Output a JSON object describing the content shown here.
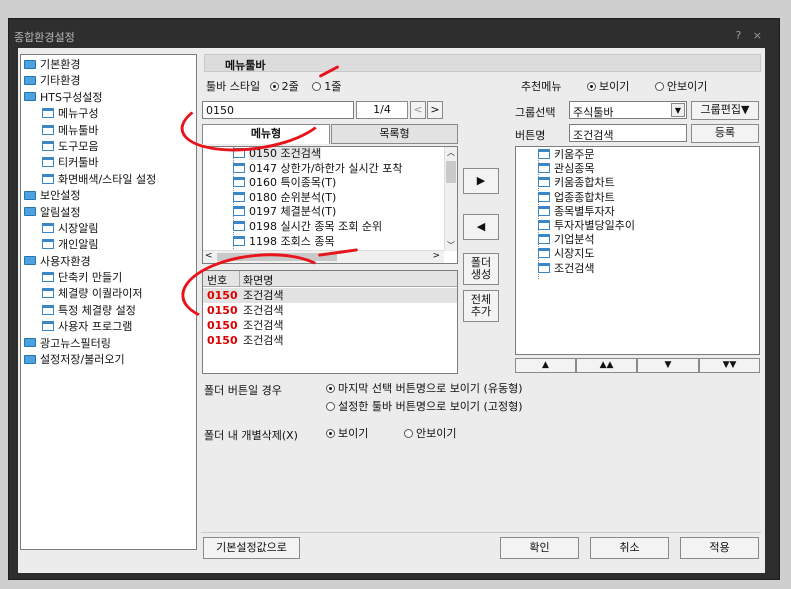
{
  "window": {
    "title": "종합환경설정",
    "controls": "? ×"
  },
  "left_tree": [
    {
      "label": "기본환경",
      "icon": "folder",
      "indent": 0
    },
    {
      "label": "기타환경",
      "icon": "folder",
      "indent": 0
    },
    {
      "label": "HTS구성설정",
      "icon": "folder",
      "indent": 0
    },
    {
      "label": "메뉴구성",
      "icon": "window",
      "indent": 1
    },
    {
      "label": "메뉴툴바",
      "icon": "window",
      "indent": 1
    },
    {
      "label": "도구모음",
      "icon": "window",
      "indent": 1
    },
    {
      "label": "티커툴바",
      "icon": "window",
      "indent": 1
    },
    {
      "label": "화면배색/스타일 설정",
      "icon": "window",
      "indent": 1
    },
    {
      "label": "보안설정",
      "icon": "folder",
      "indent": 0
    },
    {
      "label": "알림설정",
      "icon": "folder",
      "indent": 0
    },
    {
      "label": "시장알림",
      "icon": "window",
      "indent": 1
    },
    {
      "label": "개인알림",
      "icon": "window",
      "indent": 1
    },
    {
      "label": "사용자환경",
      "icon": "folder",
      "indent": 0
    },
    {
      "label": "단축키 만들기",
      "icon": "window",
      "indent": 1
    },
    {
      "label": "체결량 이퀄라이저",
      "icon": "window",
      "indent": 1
    },
    {
      "label": "특정 체결량 설정",
      "icon": "window",
      "indent": 1
    },
    {
      "label": "사용자 프로그램",
      "icon": "window",
      "indent": 1
    },
    {
      "label": "광고뉴스필터링",
      "icon": "folder",
      "indent": 0
    },
    {
      "label": "설정저장/불러오기",
      "icon": "folder",
      "indent": 0
    }
  ],
  "panel": {
    "title": "메뉴툴바",
    "toolbar_style_label": "툴바 스타일",
    "style_options": [
      "2줄",
      "1줄"
    ],
    "recommend_label": "추천메뉴",
    "recommend_options": [
      "보이기",
      "안보이기"
    ],
    "search_value": "0150",
    "page_indicator": "1/4",
    "tabs": [
      "메뉴형",
      "목록형"
    ],
    "menu_list": [
      "0150 조건검색",
      "0147 상한가/하한가 실시간 포착",
      "0160 특이종목(T)",
      "0180 순위분석(T)",
      "0197 체결분석(T)",
      "0198 실시간 종목 조회 순위",
      "1198 조회스 종목"
    ],
    "result_headers": [
      "번호",
      "화면명"
    ],
    "result_rows": [
      {
        "code": "0150",
        "name": "조건검색"
      },
      {
        "code": "0150",
        "name": "조건검색"
      },
      {
        "code": "0150",
        "name": "조건검색"
      },
      {
        "code": "0150",
        "name": "조건검색"
      }
    ],
    "add_arrow": "▶",
    "remove_arrow": "◀",
    "folder_create_label": "폴더\n생성",
    "add_all_label": "전체\n추가",
    "group_select_label": "그룹선택",
    "group_select_value": "주식툴바",
    "group_edit_label": "그룹편집▼",
    "button_name_label": "버튼명",
    "button_name_value": "조건검색",
    "register_label": "등록",
    "toolbar_items": [
      "키움주문",
      "관심종목",
      "키움종합차트",
      "업종종합차트",
      "종목별투자자",
      "투자자별당일추이",
      "기업분석",
      "시장지도",
      "조건검색"
    ],
    "move_buttons": [
      "▲",
      "▲▲",
      "▼",
      "▼▼"
    ],
    "folder_button_label": "폴더 버튼일 경우",
    "folder_button_options": [
      "마지막 선택 버튼명으로 보이기 (유동형)",
      "설정한 툴바 버튼명으로 보이기 (고정형)"
    ],
    "folder_delete_label": "폴더 내 개별삭제(X)",
    "folder_delete_options": [
      "보이기",
      "안보이기"
    ]
  },
  "footer": {
    "reset_label": "기본설정값으로",
    "ok_label": "확인",
    "cancel_label": "취소",
    "apply_label": "적용"
  },
  "colors": {
    "frame": "#2e2e2e",
    "client": "#ececec",
    "highlight": "#e8141b",
    "code_red": "#dd0000"
  }
}
